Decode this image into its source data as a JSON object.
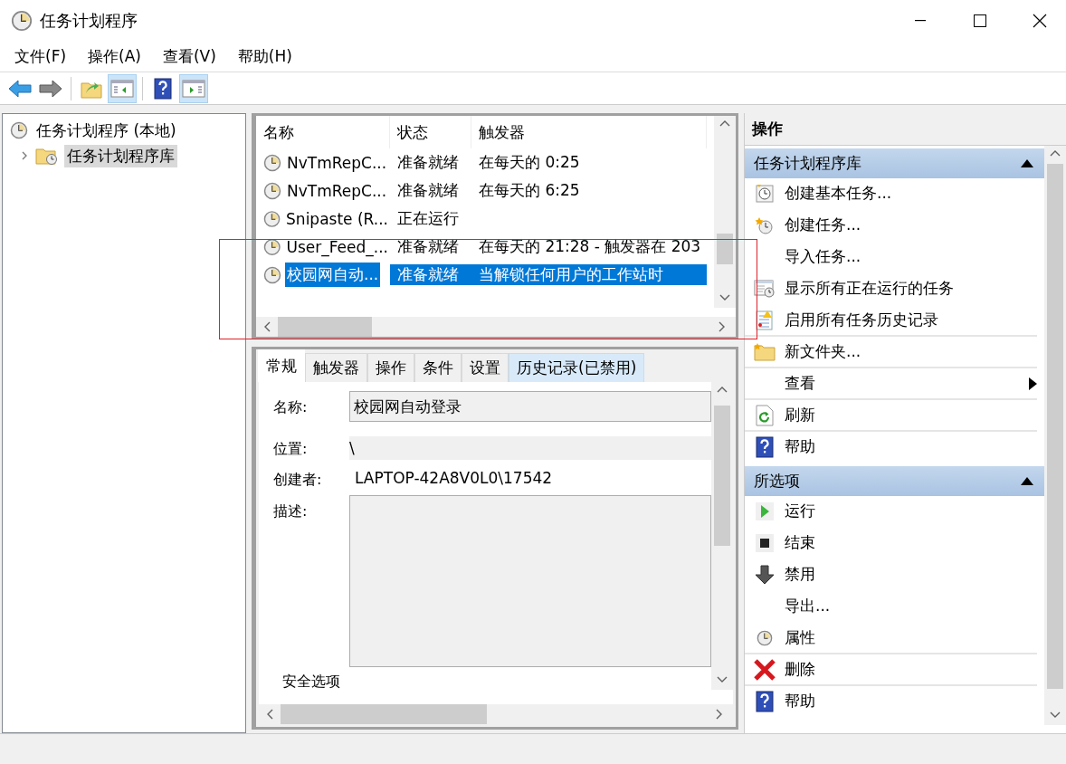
{
  "window": {
    "title": "任务计划程序"
  },
  "menu": [
    "文件(F)",
    "操作(A)",
    "查看(V)",
    "帮助(H)"
  ],
  "toolbar": [
    {
      "pressed": false
    },
    {
      "pressed": false
    },
    {
      "pressed": false
    },
    {
      "pressed": true
    },
    {
      "pressed": false
    },
    {
      "pressed": true
    }
  ],
  "tree": [
    {
      "label": "任务计划程序 (本地)",
      "selected": false,
      "children": [
        {
          "label": "任务计划程序库",
          "selected": true,
          "expanded": false
        }
      ]
    }
  ],
  "task_list": {
    "columns": [
      "名称",
      "状态",
      "触发器"
    ],
    "rows": [
      {
        "name": "NvTmRepC...",
        "status": "准备就绪",
        "trigger": "在每天的 0:25",
        "selected": false
      },
      {
        "name": "NvTmRepC...",
        "status": "准备就绪",
        "trigger": "在每天的 6:25",
        "selected": false
      },
      {
        "name": "Snipaste (R...",
        "status": "正在运行",
        "trigger": "",
        "selected": false
      },
      {
        "name": "User_Feed_...",
        "status": "准备就绪",
        "trigger": "在每天的 21:28 - 触发器在 203",
        "selected": false
      },
      {
        "name": "校园网自动...",
        "status": "准备就绪",
        "trigger": "当解锁任何用户的工作站时",
        "selected": true
      }
    ]
  },
  "highlight_frame": true,
  "detail_tabs": [
    {
      "label": "常规",
      "selected": true,
      "hover": false
    },
    {
      "label": "触发器",
      "selected": false,
      "hover": false
    },
    {
      "label": "操作",
      "selected": false,
      "hover": false
    },
    {
      "label": "条件",
      "selected": false,
      "hover": false
    },
    {
      "label": "设置",
      "selected": false,
      "hover": false
    },
    {
      "label": "历史记录(已禁用)",
      "selected": false,
      "hover": true
    }
  ],
  "general": {
    "name_label": "名称:",
    "name_value": "校园网自动登录",
    "location_label": "位置:",
    "location_value": "\\",
    "author_label": "创建者:",
    "author_value": "LAPTOP-42A8V0L0\\17542",
    "description_label": "描述:",
    "security_group": "安全选项"
  },
  "actions": {
    "title": "操作",
    "sections": [
      {
        "title": "任务计划程序库",
        "expanded": true,
        "items": [
          {
            "label": "创建基本任务...",
            "divider_after": false,
            "submenu": false
          },
          {
            "label": "创建任务...",
            "divider_after": false,
            "submenu": false
          },
          {
            "label": "导入任务...",
            "divider_after": false,
            "submenu": false
          },
          {
            "label": "显示所有正在运行的任务",
            "divider_after": false,
            "submenu": false
          },
          {
            "label": "启用所有任务历史记录",
            "divider_after": true,
            "submenu": false
          },
          {
            "label": "新文件夹...",
            "divider_after": true,
            "submenu": false
          },
          {
            "label": "查看",
            "divider_after": true,
            "submenu": true
          },
          {
            "label": "刷新",
            "divider_after": true,
            "submenu": false
          },
          {
            "label": "帮助",
            "divider_after": false,
            "submenu": false
          }
        ]
      },
      {
        "title": "所选项",
        "expanded": true,
        "items": [
          {
            "label": "运行",
            "divider_after": false,
            "submenu": false
          },
          {
            "label": "结束",
            "divider_after": false,
            "submenu": false
          },
          {
            "label": "禁用",
            "divider_after": false,
            "submenu": false
          },
          {
            "label": "导出...",
            "divider_after": false,
            "submenu": false
          },
          {
            "label": "属性",
            "divider_after": true,
            "submenu": false
          },
          {
            "label": "删除",
            "divider_after": true,
            "submenu": false
          },
          {
            "label": "帮助",
            "divider_after": false,
            "submenu": false
          }
        ]
      }
    ]
  }
}
